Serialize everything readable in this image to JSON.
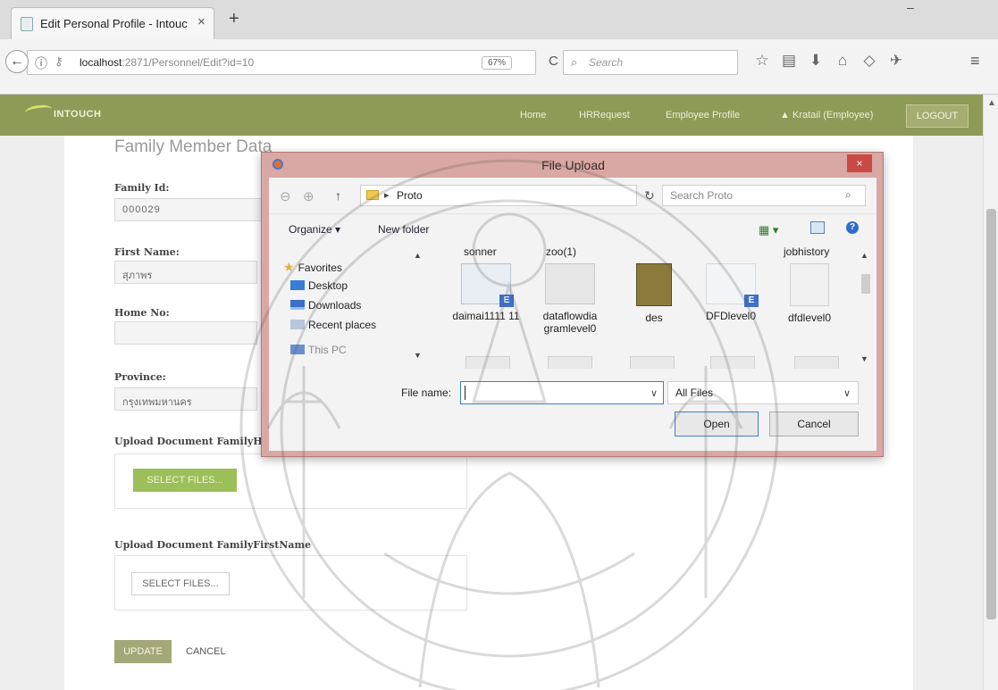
{
  "browser": {
    "tab_title": "Edit Personal Profile - Intouc",
    "tab_close": "×",
    "new_tab": "+",
    "url_host": "localhost",
    "url_rest": ":2871/Personnel/Edit?id=10",
    "zoom": "67%",
    "search_placeholder": "Search"
  },
  "app": {
    "brand": "INTOUCH",
    "nav": {
      "home": "Home",
      "hr_request": "HRRequest",
      "employee_profile": "Employee Profile",
      "user": "Kratail (Employee)",
      "logout": "LOGOUT"
    }
  },
  "form": {
    "section_title": "Family Member Data",
    "family_id_label": "Family Id:",
    "family_id_value": "000029",
    "first_name_label": "First Name:",
    "first_name_value": "สุภาพร",
    "home_no_label": "Home No:",
    "home_no_value": "",
    "province_label": "Province:",
    "province_value": "กรุงเทพมหานคร",
    "upload_home_label": "Upload Document FamilyHome",
    "upload_first_label": "Upload Document FamilyFirstName",
    "select_files": "SELECT FILES...",
    "update": "UPDATE",
    "cancel": "CANCEL"
  },
  "dialog": {
    "title": "File Upload",
    "close": "×",
    "path": "Proto",
    "search_placeholder": "Search Proto",
    "organize": "Organize ▾",
    "new_folder": "New folder",
    "help": "?",
    "nav_items": {
      "favorites": "Favorites",
      "desktop": "Desktop",
      "downloads": "Downloads",
      "recent": "Recent places",
      "this_pc": "This PC"
    },
    "partial_names": {
      "sonner": "sonner",
      "zoo": "zoo(1)",
      "jobhistory": "jobhistory"
    },
    "files": [
      {
        "name": "daimai1111 11"
      },
      {
        "name": "dataflowdia gramlevel0"
      },
      {
        "name": "des"
      },
      {
        "name": "DFDlevel0"
      },
      {
        "name": "dfdlevel0"
      }
    ],
    "file_name_label": "File name:",
    "file_name_value": "",
    "filter": "All Files",
    "open": "Open",
    "cancel": "Cancel"
  }
}
